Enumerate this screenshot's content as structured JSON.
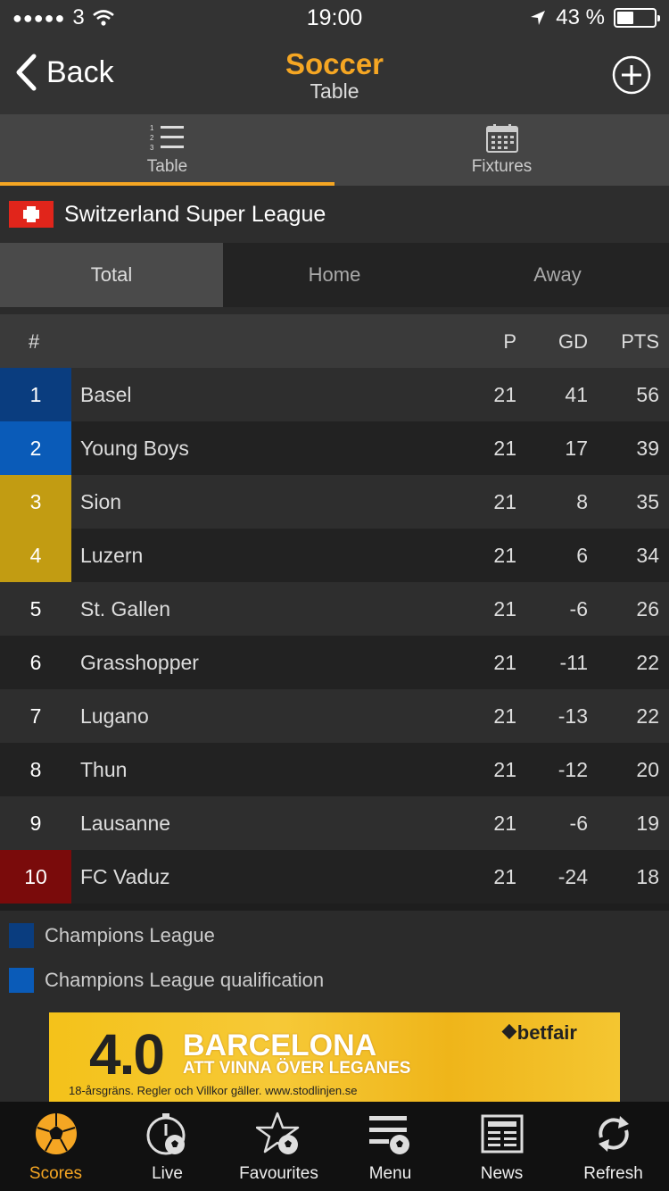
{
  "status_bar": {
    "carrier": "3",
    "time": "19:00",
    "battery": "43 %"
  },
  "nav": {
    "back_label": "Back",
    "title": "Soccer",
    "subtitle": "Table"
  },
  "tabs": [
    {
      "label": "Table",
      "icon": "list-icon",
      "active": true
    },
    {
      "label": "Fixtures",
      "icon": "calendar-icon",
      "active": false
    }
  ],
  "league": {
    "name": "Switzerland Super League",
    "flag": "switzerland-flag"
  },
  "segments": [
    {
      "label": "Total",
      "active": true
    },
    {
      "label": "Home",
      "active": false
    },
    {
      "label": "Away",
      "active": false
    }
  ],
  "table": {
    "headers": {
      "pos": "#",
      "p": "P",
      "gd": "GD",
      "pts": "PTS"
    },
    "rows": [
      {
        "pos": "1",
        "team": "Basel",
        "p": "21",
        "gd": "41",
        "pts": "56",
        "zone_color": "#0a3d7f"
      },
      {
        "pos": "2",
        "team": "Young Boys",
        "p": "21",
        "gd": "17",
        "pts": "39",
        "zone_color": "#0a5bb8"
      },
      {
        "pos": "3",
        "team": "Sion",
        "p": "21",
        "gd": "8",
        "pts": "35",
        "zone_color": "#c29c12"
      },
      {
        "pos": "4",
        "team": "Luzern",
        "p": "21",
        "gd": "6",
        "pts": "34",
        "zone_color": "#c29c12"
      },
      {
        "pos": "5",
        "team": "St. Gallen",
        "p": "21",
        "gd": "-6",
        "pts": "26",
        "zone_color": ""
      },
      {
        "pos": "6",
        "team": "Grasshopper",
        "p": "21",
        "gd": "-11",
        "pts": "22",
        "zone_color": ""
      },
      {
        "pos": "7",
        "team": "Lugano",
        "p": "21",
        "gd": "-13",
        "pts": "22",
        "zone_color": ""
      },
      {
        "pos": "8",
        "team": "Thun",
        "p": "21",
        "gd": "-12",
        "pts": "20",
        "zone_color": ""
      },
      {
        "pos": "9",
        "team": "Lausanne",
        "p": "21",
        "gd": "-6",
        "pts": "19",
        "zone_color": ""
      },
      {
        "pos": "10",
        "team": "FC Vaduz",
        "p": "21",
        "gd": "-24",
        "pts": "18",
        "zone_color": "#7a0b0b"
      }
    ]
  },
  "legend": [
    {
      "label": "Champions League",
      "color": "#0a3d7f"
    },
    {
      "label": "Champions League qualification",
      "color": "#0a5bb8"
    }
  ],
  "ad": {
    "odds": "4.0",
    "headline": "BARCELONA",
    "subline": "ATT VINNA ÖVER LEGANES",
    "brand": "betfair",
    "fine_print": "18-årsgräns. Regler och Villkor gäller. www.stodlinjen.se"
  },
  "bottom_tabs": [
    {
      "label": "Scores",
      "icon": "soccer-ball-icon",
      "active": true
    },
    {
      "label": "Live",
      "icon": "stopwatch-ball-icon",
      "active": false
    },
    {
      "label": "Favourites",
      "icon": "star-ball-icon",
      "active": false
    },
    {
      "label": "Menu",
      "icon": "menu-ball-icon",
      "active": false
    },
    {
      "label": "News",
      "icon": "newspaper-icon",
      "active": false
    },
    {
      "label": "Refresh",
      "icon": "refresh-icon",
      "active": false
    }
  ],
  "colors": {
    "accent": "#f5a623",
    "background": "#2b2b2b"
  }
}
